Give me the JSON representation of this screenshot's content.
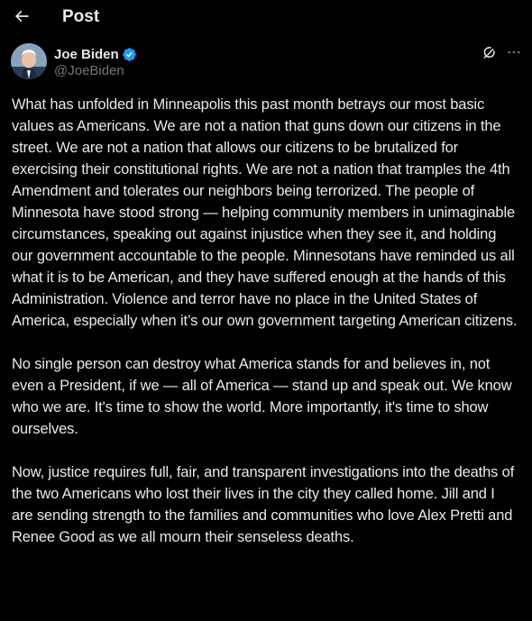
{
  "header": {
    "title": "Post",
    "back_icon": "arrow-left-icon"
  },
  "author": {
    "display_name": "Joe Biden",
    "handle": "@JoeBiden",
    "verified_color": "#1d9bf0",
    "avatar_icon": "avatar"
  },
  "actions": {
    "grok_icon": "grok-icon",
    "more_icon": "more-dots-icon"
  },
  "post": {
    "paragraphs": [
      "What has unfolded in Minneapolis this past month betrays our most basic values as Americans. We are not a nation that guns down our citizens in the street. We are not a nation that allows our citizens to be brutalized for exercising their constitutional rights. We are not a nation that tramples the 4th Amendment and tolerates our neighbors being terrorized. The people of Minnesota have stood strong — helping community members in unimaginable circumstances, speaking out against injustice when they see it, and holding our government accountable to the people. Minnesotans have reminded us all what it is to be American, and they have suffered enough at the hands of this Administration. Violence and terror have no place in the United States of America, especially when it’s our own government targeting American citizens.",
      "No single person can destroy what America stands for and believes in, not even a President, if we — all of America — stand up and speak out. We know who we are. It's time to show the world. More importantly, it's time to show ourselves.",
      "Now, justice requires full, fair, and transparent investigations into the deaths of the two Americans who lost their lives in the city they called home. Jill and I are sending strength to the families and communities who love Alex Pretti and Renee Good as we all mourn their senseless deaths."
    ]
  },
  "colors": {
    "background": "#000000",
    "text_primary": "#e7e9ea",
    "text_secondary": "#71767b",
    "accent": "#1d9bf0"
  }
}
